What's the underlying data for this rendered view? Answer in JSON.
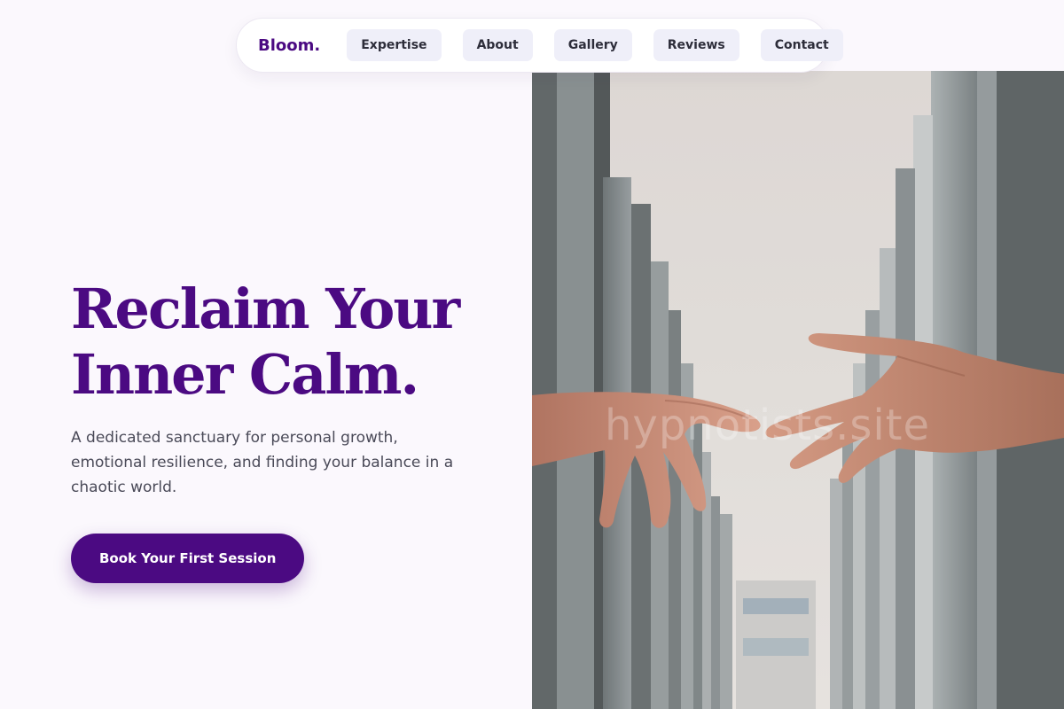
{
  "nav": {
    "brand": "Bloom.",
    "links": [
      {
        "label": "Expertise"
      },
      {
        "label": "About"
      },
      {
        "label": "Gallery"
      },
      {
        "label": "Reviews"
      },
      {
        "label": "Contact"
      }
    ]
  },
  "hero": {
    "title_line1": "Reclaim Your",
    "title_line2": "Inner Calm.",
    "description": "A dedicated sanctuary for personal growth, emotional resilience, and finding your balance in a chaotic world.",
    "cta_label": "Book Your First Session",
    "image": {
      "watermark": "hypnotists.site"
    }
  },
  "colors": {
    "brand_purple": "#4b0a82",
    "page_bg": "#fbf8fd",
    "nav_pill_bg": "#efeff9",
    "body_text": "#4a4a58"
  }
}
